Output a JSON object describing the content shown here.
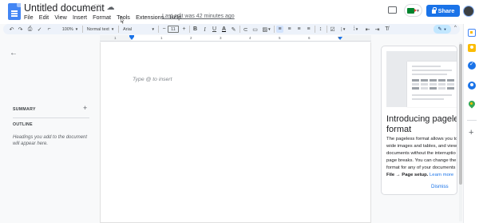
{
  "title_bar": {
    "doc_title": "Untitled document",
    "icons": [
      "star-icon",
      "move-folder-icon",
      "cloud-saved-icon"
    ],
    "menu": [
      "File",
      "Edit",
      "View",
      "Insert",
      "Format",
      "Tools",
      "Extensions",
      "Help"
    ],
    "last_edit": "Last edit was 42 minutes ago",
    "share_label": "Share"
  },
  "toolbar": {
    "zoom": "100%",
    "style": "Normal text",
    "font": "Arial",
    "font_size": "11",
    "minus": "−",
    "plus": "+",
    "bold": "B",
    "italic": "I",
    "underline": "U",
    "font_color": "A",
    "edit_mode_icon": "✎"
  },
  "ruler": {
    "numbers": [
      "1",
      "1",
      "2",
      "3",
      "4",
      "5",
      "6",
      "7"
    ]
  },
  "outline_panel": {
    "summary_label": "SUMMARY",
    "outline_label": "OUTLINE",
    "hint": "Headings you add to the document will appear here."
  },
  "page": {
    "hint": "Type @ to insert"
  },
  "promo": {
    "title_line1": "Introducing pageless",
    "title_line2": "format",
    "body_lines": [
      "The pageless format allows you to",
      "wide images and tables, and view",
      "documents without the interruptio",
      "page breaks. You can change the",
      "format for any of your documents"
    ],
    "body_last_bold": "File → Page setup.",
    "learn_more": "Learn more",
    "dismiss": "Dismiss"
  },
  "colors": {
    "accent": "#1a73e8",
    "toolbar_bg": "#edf2fa",
    "page_bg": "#f8f9fa"
  }
}
